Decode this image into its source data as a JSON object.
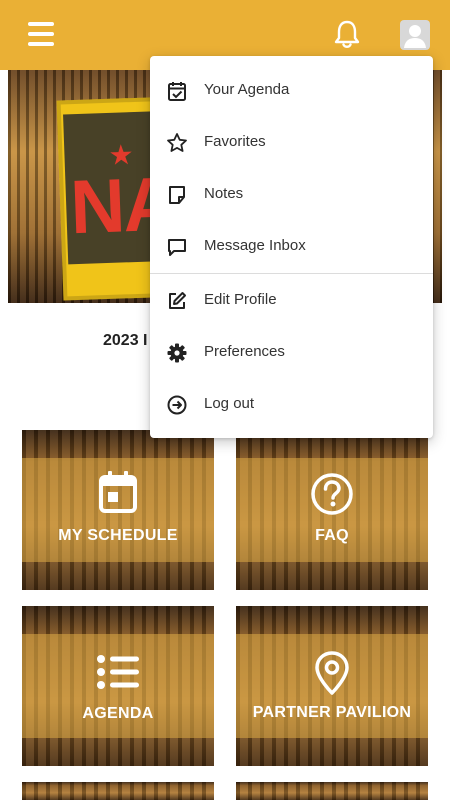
{
  "header": {
    "menu_icon": "hamburger-menu-icon",
    "notification_icon": "bell-icon",
    "profile_icon": "user-avatar-icon",
    "background_color": "#eab035"
  },
  "hero": {
    "poster_text": "NA",
    "poster_subtext": "A"
  },
  "event": {
    "title_partial": "2023 I"
  },
  "tiles": [
    {
      "label": "MY SCHEDULE",
      "icon": "calendar-icon"
    },
    {
      "label": "FAQ",
      "icon": "question-circle-icon"
    },
    {
      "label": "AGENDA",
      "icon": "list-icon"
    },
    {
      "label": "PARTNER PAVILION",
      "icon": "map-pin-icon"
    }
  ],
  "dropdown": {
    "items": [
      {
        "label": "Your Agenda",
        "icon": "calendar-check-icon"
      },
      {
        "label": "Favorites",
        "icon": "star-icon"
      },
      {
        "label": "Notes",
        "icon": "note-icon"
      },
      {
        "label": "Message Inbox",
        "icon": "chat-icon"
      },
      {
        "label": "Edit Profile",
        "icon": "edit-icon"
      },
      {
        "label": "Preferences",
        "icon": "gear-icon"
      },
      {
        "label": "Log out",
        "icon": "logout-icon"
      }
    ]
  }
}
